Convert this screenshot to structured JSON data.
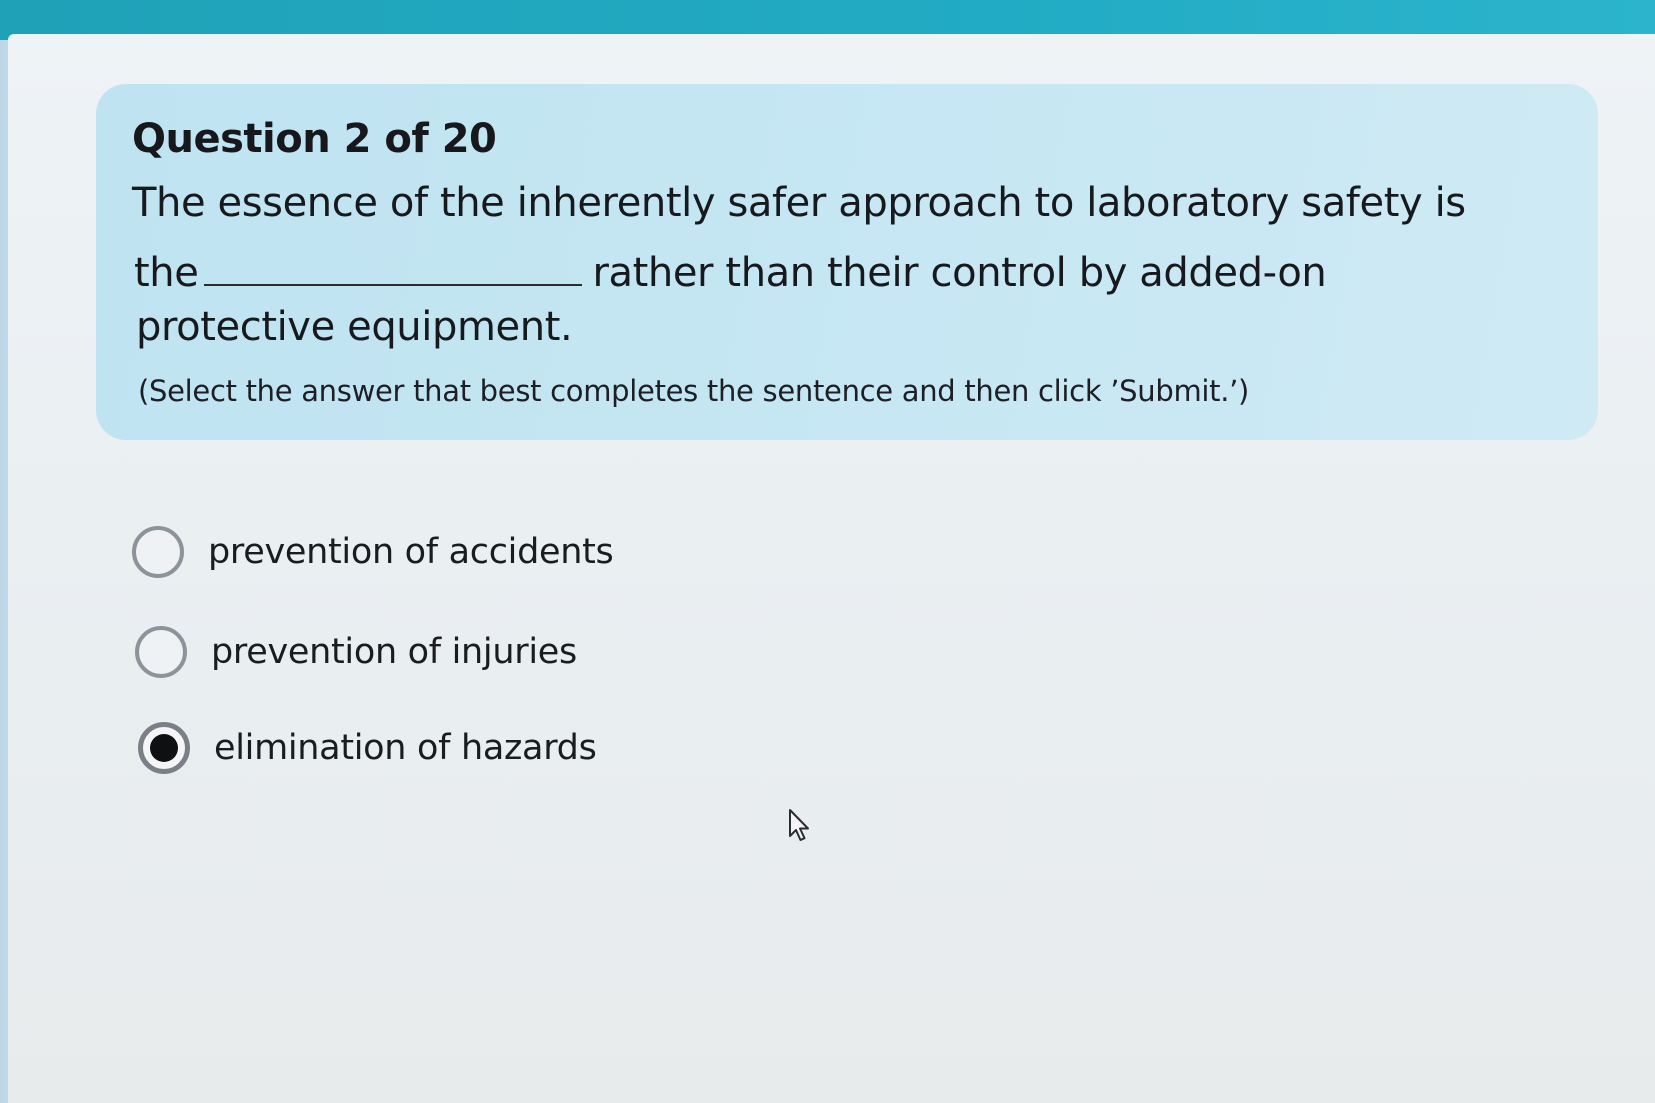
{
  "question": {
    "number_label": "Question 2 of 20",
    "stem_line_1": "The essence of the inherently safer approach to laboratory safety is",
    "stem_line_2_before_blank": "the",
    "stem_line_2_after_blank": "rather than their control by added-on",
    "stem_line_3": "protective equipment.",
    "instruction": "(Select the answer that best completes the sentence and then click ’Submit.’)"
  },
  "options": [
    {
      "label": "prevention of accidents",
      "selected": false
    },
    {
      "label": "prevention of injuries",
      "selected": false
    },
    {
      "label": "elimination of hazards",
      "selected": true
    }
  ],
  "colors": {
    "top_bar": "#1fa2b8",
    "question_panel": "#c4e5f2",
    "page_background": "#e9eef1",
    "radio_selected_dot": "#0f1012"
  },
  "icons": {
    "cursor": "mouse-pointer-icon"
  }
}
